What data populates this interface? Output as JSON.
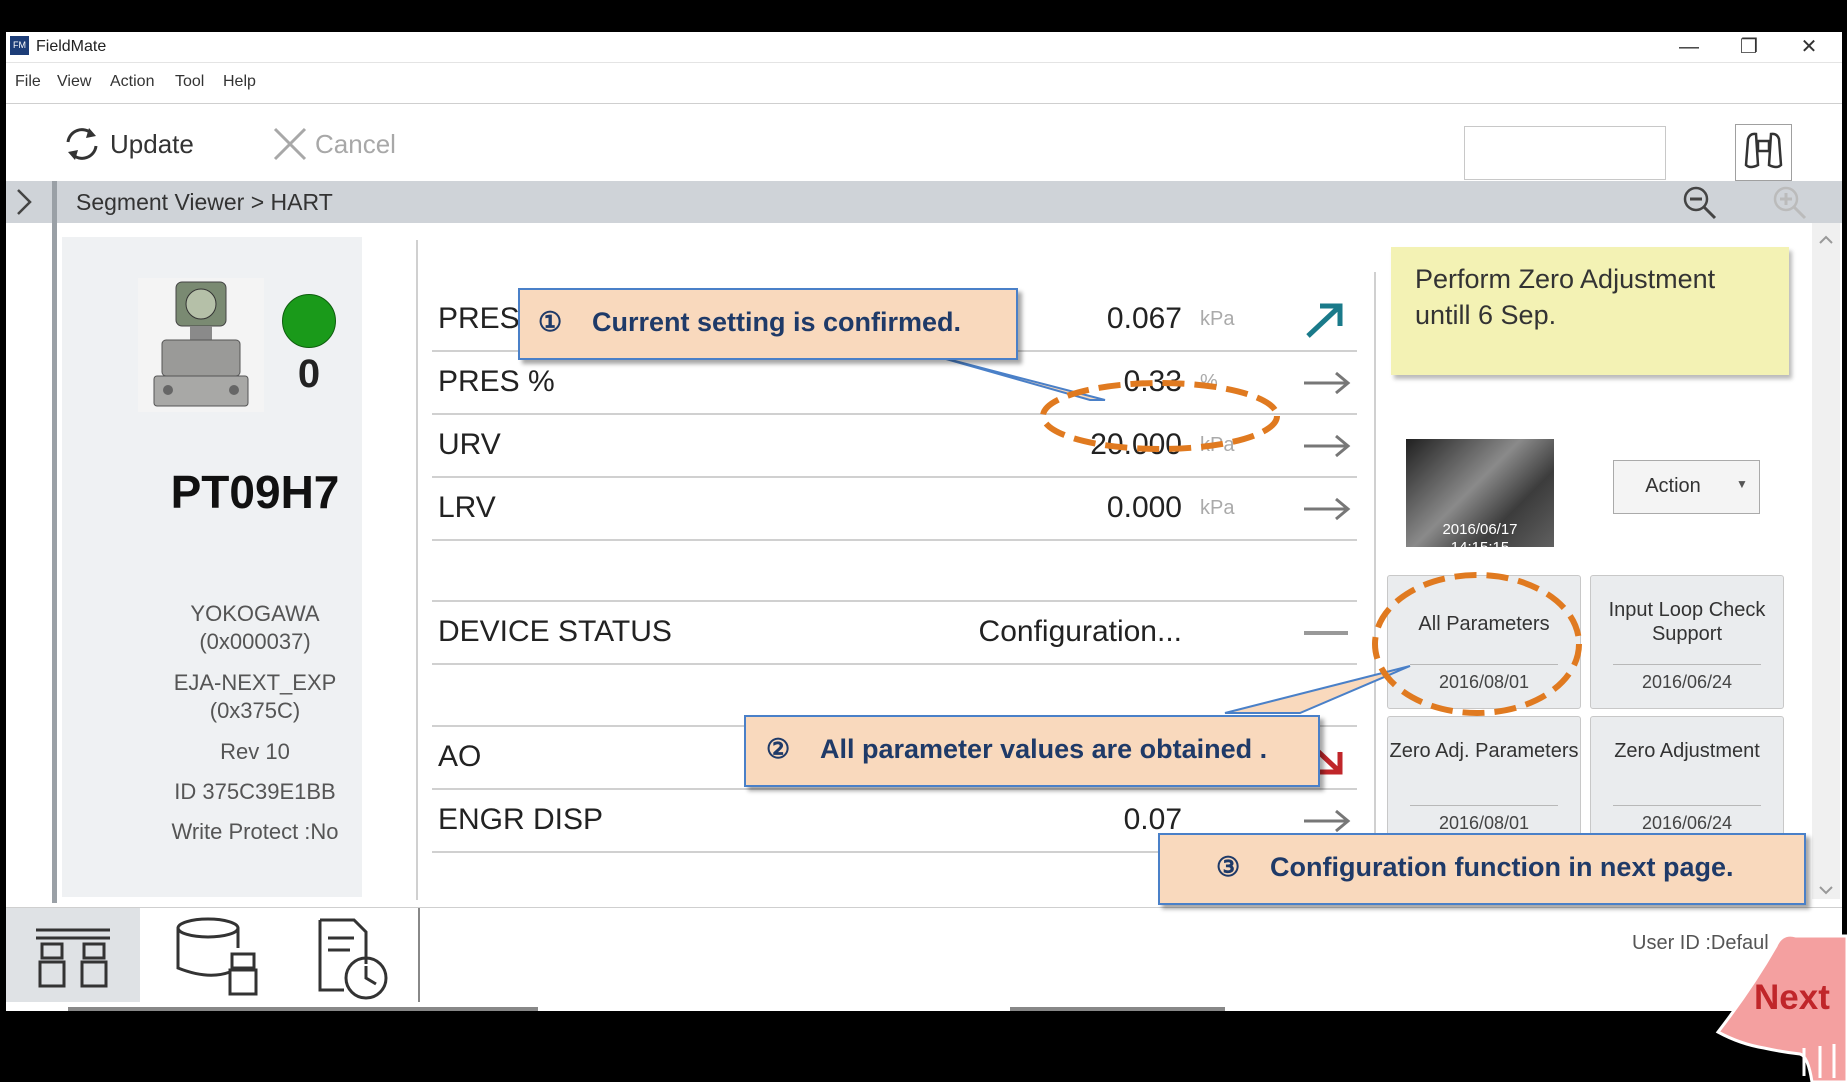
{
  "window": {
    "title": "FieldMate",
    "logo_text": "FM",
    "minimize": "—",
    "restore": "❐",
    "close": "✕"
  },
  "menu": [
    "File",
    "View",
    "Action",
    "Tool",
    "Help"
  ],
  "toolbar": {
    "update_label": "Update",
    "cancel_label": "Cancel",
    "search_value": ""
  },
  "breadcrumb": "Segment Viewer > HART",
  "device": {
    "status_count": "0",
    "status_color": "#1a9a1a",
    "tag": "PT09H7",
    "info": [
      "YOKOGAWA",
      "(0x000037)",
      "EJA-NEXT_EXP",
      "(0x375C)",
      "Rev 10",
      "ID 375C39E1BB",
      "Write Protect :No"
    ]
  },
  "params": [
    {
      "label": "PRES",
      "value": "0.067",
      "unit": "kPa",
      "arrow": "trend-up-icon"
    },
    {
      "label": "PRES %",
      "value": "0.33",
      "unit": "%",
      "arrow": "arrow-right-icon"
    },
    {
      "label": "URV",
      "value": "20.000",
      "unit": "kPa",
      "arrow": "arrow-right-icon"
    },
    {
      "label": "LRV",
      "value": "0.000",
      "unit": "kPa",
      "arrow": "arrow-right-icon"
    },
    {
      "label": "DEVICE STATUS",
      "value": "Configuration...",
      "unit": "",
      "arrow": "dash-icon"
    },
    {
      "label": "AO",
      "value": "",
      "unit": "",
      "arrow": "trend-down-icon"
    },
    {
      "label": "ENGR DISP",
      "value": "0.07",
      "unit": "",
      "arrow": "arrow-right-icon"
    }
  ],
  "note": "Perform Zero Adjustment untill 6 Sep.",
  "photo": {
    "date": "2016/06/17",
    "time": "14:15:15"
  },
  "action_button": "Action",
  "cards": [
    {
      "label": "All Parameters",
      "date": "2016/08/01"
    },
    {
      "label": "Input Loop Check Support",
      "date": "2016/06/24"
    },
    {
      "label": "Zero Adj. Parameters",
      "date": "2016/08/01"
    },
    {
      "label": "Zero Adjustment",
      "date": "2016/06/24"
    }
  ],
  "user_id": "User ID :Defaul",
  "callouts": {
    "one": {
      "num": "①",
      "text": "Current setting is confirmed."
    },
    "two": {
      "num": "②",
      "text": "All parameter values are obtained ."
    },
    "three": {
      "num": "③",
      "text": "Configuration function in next page."
    }
  },
  "next_label": "Next",
  "colors": {
    "accent_arrow": "#1a7a8a",
    "callout_bg": "#f9d9bd",
    "callout_border": "#4a80c8",
    "highlight_ring": "#e07a20",
    "note_bg": "#f3f2b4",
    "next_hand": "#f4a0a0"
  }
}
